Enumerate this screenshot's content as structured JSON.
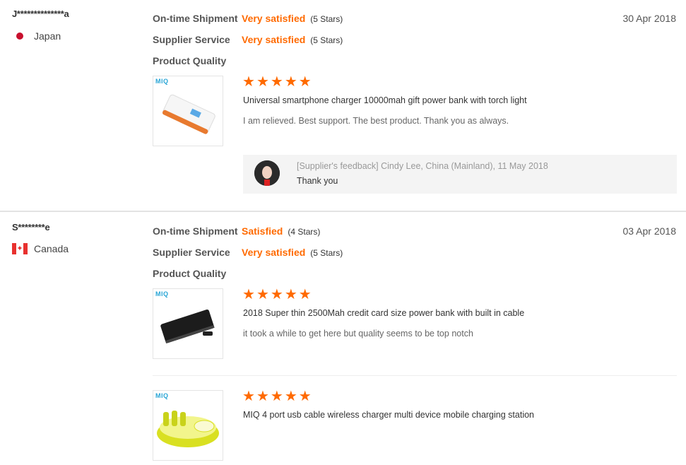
{
  "reviews": [
    {
      "buyer": "J**************a",
      "country": "Japan",
      "date": "30 Apr 2018",
      "ratings": [
        {
          "label": "On-time Shipment",
          "value": "Very satisfied",
          "stars": "(5 Stars)"
        },
        {
          "label": "Supplier Service",
          "value": "Very satisfied",
          "stars": "(5 Stars)"
        },
        {
          "label": "Product Quality"
        }
      ],
      "products": [
        {
          "logo": "MIQ",
          "rating": 5,
          "title": "Universal smartphone charger 10000mah gift power bank with torch light",
          "comment": "I am relieved. Best support. The best product. Thank you as always."
        }
      ],
      "feedback": {
        "meta": "[Supplier's feedback] Cindy Lee, China (Mainland), 11 May 2018",
        "text": "Thank you"
      }
    },
    {
      "buyer": "S********e",
      "country": "Canada",
      "date": "03 Apr 2018",
      "ratings": [
        {
          "label": "On-time Shipment",
          "value": "Satisfied",
          "stars": "(4 Stars)"
        },
        {
          "label": "Supplier Service",
          "value": "Very satisfied",
          "stars": "(5 Stars)"
        },
        {
          "label": "Product Quality"
        }
      ],
      "products": [
        {
          "logo": "MIQ",
          "rating": 5,
          "title": "2018 Super thin 2500Mah credit card size power bank with built in cable",
          "comment": "it took a while to get here but quality seems to be top notch"
        },
        {
          "logo": "MIQ",
          "rating": 5,
          "title": "MIQ 4 port usb cable wireless charger multi device mobile charging station"
        }
      ]
    }
  ],
  "colors": {
    "accent": "#ff6a00",
    "divider": "#e3e3e3",
    "feedback_bg": "#f4f4f4"
  }
}
